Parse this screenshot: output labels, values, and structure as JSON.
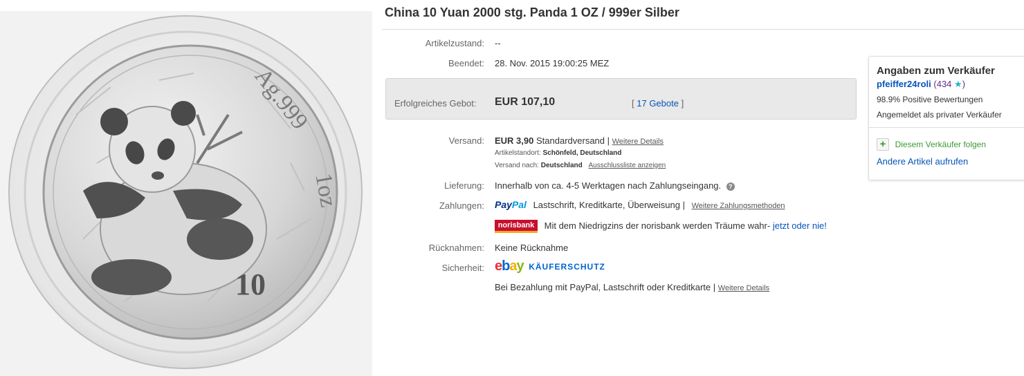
{
  "listing": {
    "title": "China 10 Yuan 2000 stg. Panda 1 OZ / 999er Silber"
  },
  "coin": {
    "inscription_ag": "Ag.999",
    "inscription_weight": "1oz",
    "denomination": "10"
  },
  "details": {
    "condition_label": "Artikelzustand:",
    "condition_value": "--",
    "ended_label": "Beendet:",
    "ended_value": "28. Nov. 2015  19:00:25 MEZ"
  },
  "bid": {
    "label": "Erfolgreiches Gebot:",
    "amount": "EUR 107,10",
    "bracket_open": "[",
    "bids_link": "17 Gebote",
    "bracket_close": "]"
  },
  "shipping": {
    "label": "Versand:",
    "cost": "EUR 3,90",
    "method": "Standardversand |",
    "details_link": "Weitere Details",
    "location_label": "Artikelstandort:",
    "location_value": "Schönfeld, Deutschland",
    "to_label": "Versand nach:",
    "to_value": "Deutschland",
    "exclusion_link": "Ausschlussliste anzeigen"
  },
  "delivery": {
    "label": "Lieferung:",
    "value": "Innerhalb von ca. 4-5 Werktagen nach Zahlungseingang."
  },
  "payments": {
    "label": "Zahlungen:",
    "paypal_part1": "Pay",
    "paypal_part2": "Pal",
    "methods": "Lastschrift,  Kreditkarte,  Überweisung |",
    "more_link": "Weitere Zahlungsmethoden",
    "norisbank_logo": "norisbank",
    "norisbank_text": "Mit dem Niedrigzins der norisbank werden Träume wahr-",
    "norisbank_link": "jetzt oder nie!"
  },
  "returns": {
    "label": "Rücknahmen:",
    "value": "Keine Rücknahme"
  },
  "security": {
    "label": "Sicherheit:",
    "ebay_e": "e",
    "ebay_b": "b",
    "ebay_a": "a",
    "ebay_y": "y",
    "protection": "KÄUFERSCHUTZ",
    "text": "Bei Bezahlung mit PayPal, Lastschrift oder Kreditkarte |",
    "details_link": "Weitere Details"
  },
  "seller": {
    "heading": "Angaben zum Verkäufer",
    "name": "pfeiffer24roli",
    "score_open": "(",
    "score": "434",
    "score_close": ")",
    "positive": "98.9% Positive Bewertungen",
    "status": "Angemeldet als privater Verkäufer",
    "follow": "Diesem Verkäufer folgen",
    "other_items": "Andere Artikel aufrufen"
  },
  "colors": {
    "link_blue": "#0654ba",
    "follow_green": "#3c9a32",
    "bid_box_bg": "#e9e9e9"
  },
  "icons": {
    "help": "help-icon",
    "star": "star-icon",
    "follow": "plus-icon"
  }
}
